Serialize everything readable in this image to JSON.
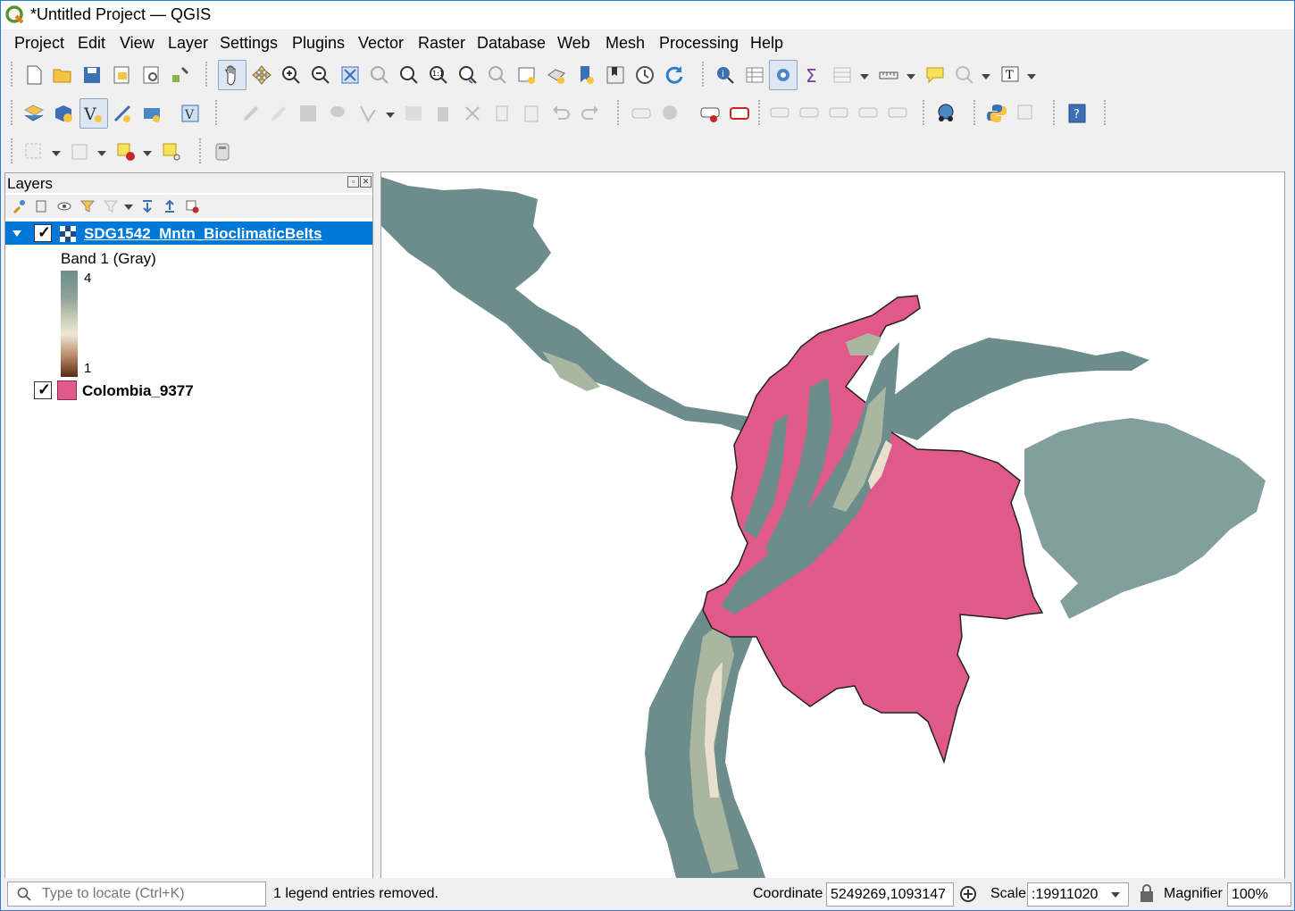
{
  "window": {
    "title": "*Untitled Project — QGIS"
  },
  "menu": [
    "Project",
    "Edit",
    "View",
    "Layer",
    "Settings",
    "Plugins",
    "Vector",
    "Raster",
    "Database",
    "Web",
    "Mesh",
    "Processing",
    "Help"
  ],
  "layers_panel": {
    "title": "Layers",
    "layers": [
      {
        "name": "SDG1542_Mntn_BioclimaticBelts",
        "checked": true,
        "selected": true,
        "legend": {
          "band_label": "Band 1 (Gray)",
          "max_label": "4",
          "min_label": "1"
        }
      },
      {
        "name": "Colombia_9377",
        "checked": true,
        "selected": false,
        "fill_color": "#e15989"
      }
    ]
  },
  "colors": {
    "raster_dark": "#6c8d8c",
    "raster_mid": "#a9b7a1",
    "raster_light": "#e8e0cc",
    "vector_fill": "#e15989",
    "selection": "#0078d7"
  },
  "statusbar": {
    "locate_placeholder": "Type to locate (Ctrl+K)",
    "message": "1 legend entries removed.",
    "coordinate_label": "Coordinate",
    "coordinate_value": "5249269,1093147",
    "scale_label": "Scale",
    "scale_value": ":19911020",
    "magnifier_label": "Magnifier",
    "magnifier_value": "100%"
  },
  "icons": [
    "new-project-icon",
    "open-project-icon",
    "save-project-icon",
    "pan-icon",
    "zoom-in-icon",
    "zoom-out-icon",
    "identify-icon",
    "sum-icon",
    "python-icon",
    "help-icon"
  ]
}
